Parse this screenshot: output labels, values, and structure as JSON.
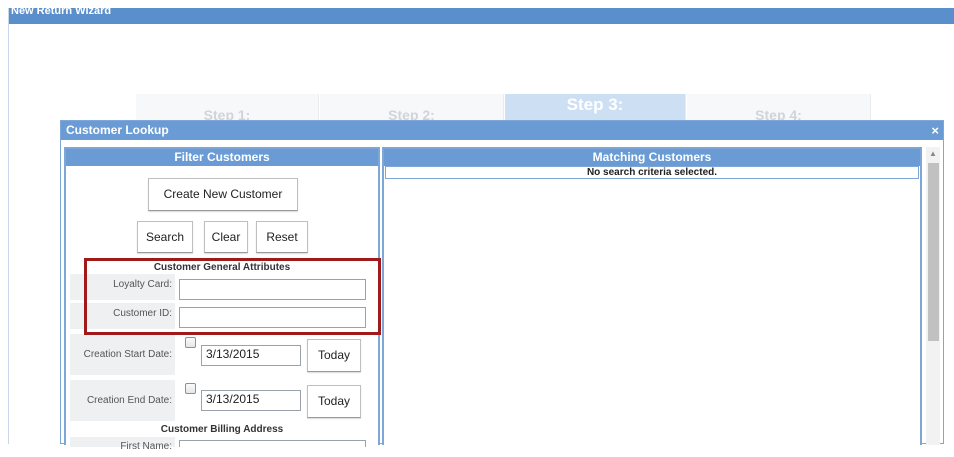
{
  "wizard": {
    "title": "New Return Wizard",
    "steps": [
      {
        "label": "Step 1:"
      },
      {
        "label": "Step 2:"
      },
      {
        "label": "Step 3:"
      },
      {
        "label": "Step 4:"
      }
    ]
  },
  "dialog": {
    "title": "Customer Lookup",
    "close_icon": "×",
    "filter": {
      "header": "Filter Customers",
      "create_button": "Create New Customer",
      "search_button": "Search",
      "clear_button": "Clear",
      "reset_button": "Reset",
      "general_section": "Customer General Attributes",
      "loyalty_label": "Loyalty Card:",
      "loyalty_value": "",
      "customer_id_label": "Customer ID:",
      "customer_id_value": "",
      "start_label": "Creation Start Date:",
      "start_value": "3/13/2015",
      "start_today": "Today",
      "end_label": "Creation End Date:",
      "end_value": "3/13/2015",
      "end_today": "Today",
      "billing_section": "Customer Billing Address",
      "first_name_label": "First Name:"
    },
    "matching": {
      "header": "Matching Customers",
      "message": "No search criteria selected."
    }
  },
  "colors": {
    "header_blue": "#6a9bd4",
    "highlight_red": "#a01a1a"
  },
  "icons": {
    "close": "close-icon",
    "checkbox": "checkbox-icon",
    "scroll_up": "arrow-up-icon"
  }
}
